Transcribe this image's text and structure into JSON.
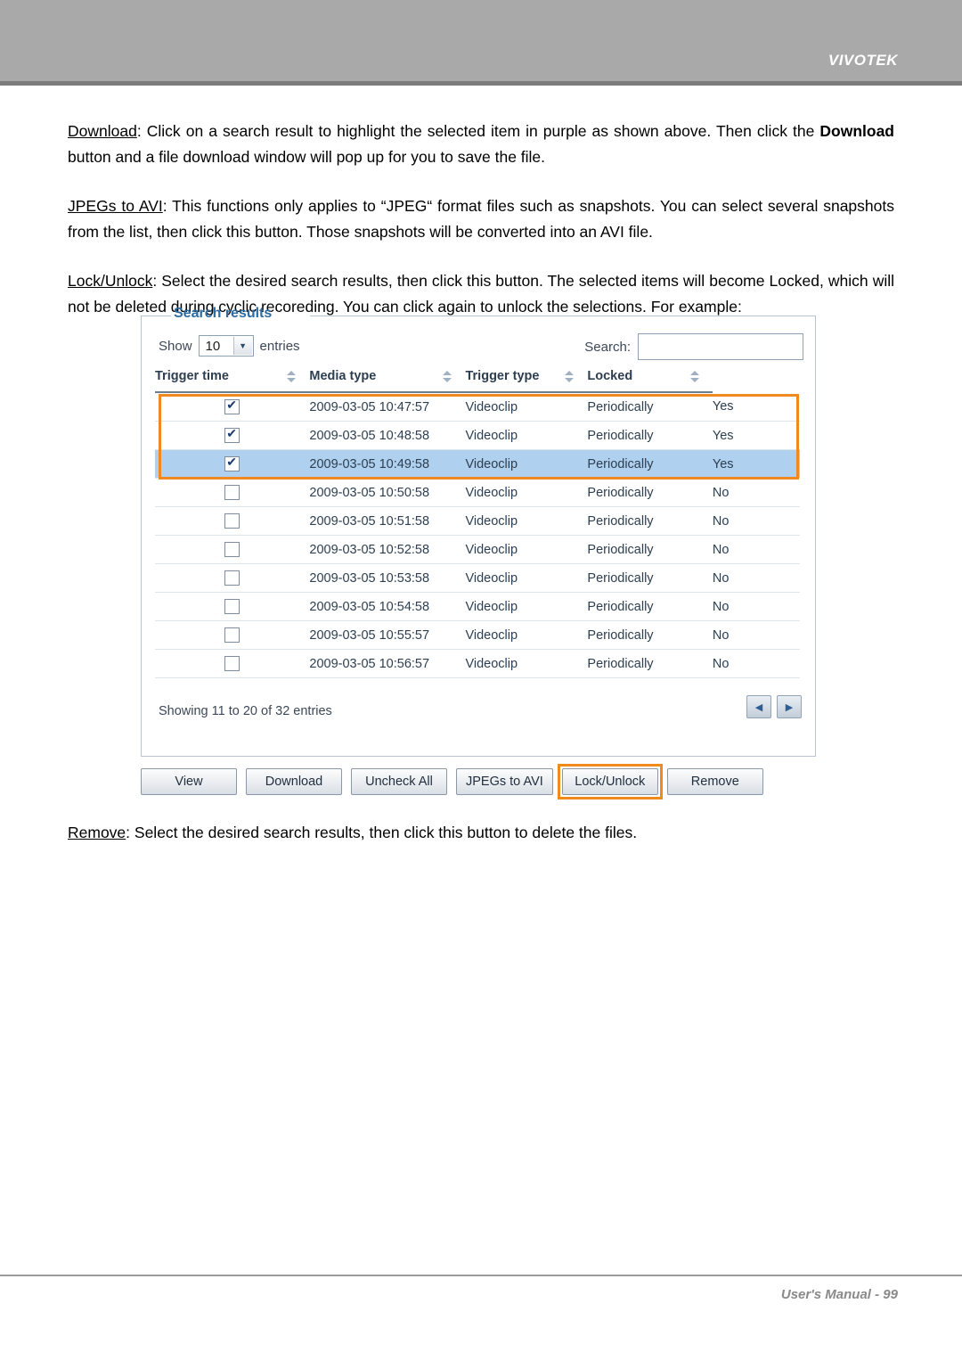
{
  "header": {
    "brand": "VIVOTEK"
  },
  "paragraphs": [
    {
      "term": "Download",
      "term_style": "underline",
      "pre": "",
      "text_1": ": Click on a search result to highlight the selected item in purple as shown above. Then click the ",
      "bold": "Download",
      "text_2": " button and a file download window will pop up for you to save the file."
    },
    {
      "term": "JPEGs to AVI",
      "text_1": ": This functions only applies to “JPEG“ format files such as snapshots. You can select several snapshots from the list, then click this button. Those snapshots will be converted into an AVI file."
    },
    {
      "term": "Lock/Unlock",
      "text_1": ": Select the desired search results, then click this button. The selected items will become Locked, which will not be deleted during cyclic recoreding. You can click again to unlock the selections. For example:"
    }
  ],
  "remove_paragraph": {
    "term": "Remove",
    "text_1": ": Select the desired search results, then click this button to delete the files."
  },
  "screenshot": {
    "legend": "Search results",
    "show_label": "Show",
    "show_value": "10",
    "entries_label": "entries",
    "search_label": "Search:",
    "search_value": "",
    "columns": [
      "Trigger time",
      "Media type",
      "Trigger type",
      "Locked"
    ],
    "rows": [
      {
        "checked": true,
        "selected": false,
        "time": "2009-03-05 10:47:57",
        "media": "Videoclip",
        "trigger": "Periodically",
        "locked": "Yes"
      },
      {
        "checked": true,
        "selected": false,
        "time": "2009-03-05 10:48:58",
        "media": "Videoclip",
        "trigger": "Periodically",
        "locked": "Yes"
      },
      {
        "checked": true,
        "selected": true,
        "time": "2009-03-05 10:49:58",
        "media": "Videoclip",
        "trigger": "Periodically",
        "locked": "Yes"
      },
      {
        "checked": false,
        "selected": false,
        "time": "2009-03-05 10:50:58",
        "media": "Videoclip",
        "trigger": "Periodically",
        "locked": "No"
      },
      {
        "checked": false,
        "selected": false,
        "time": "2009-03-05 10:51:58",
        "media": "Videoclip",
        "trigger": "Periodically",
        "locked": "No"
      },
      {
        "checked": false,
        "selected": false,
        "time": "2009-03-05 10:52:58",
        "media": "Videoclip",
        "trigger": "Periodically",
        "locked": "No"
      },
      {
        "checked": false,
        "selected": false,
        "time": "2009-03-05 10:53:58",
        "media": "Videoclip",
        "trigger": "Periodically",
        "locked": "No"
      },
      {
        "checked": false,
        "selected": false,
        "time": "2009-03-05 10:54:58",
        "media": "Videoclip",
        "trigger": "Periodically",
        "locked": "No"
      },
      {
        "checked": false,
        "selected": false,
        "time": "2009-03-05 10:55:57",
        "media": "Videoclip",
        "trigger": "Periodically",
        "locked": "No"
      },
      {
        "checked": false,
        "selected": false,
        "time": "2009-03-05 10:56:57",
        "media": "Videoclip",
        "trigger": "Periodically",
        "locked": "No"
      }
    ],
    "showing": "Showing 11 to 20 of 32 entries",
    "prev_icon": "◀",
    "next_icon": "▶",
    "buttons": [
      {
        "label": "View",
        "highlighted": false
      },
      {
        "label": "Download",
        "highlighted": false
      },
      {
        "label": "Uncheck All",
        "highlighted": false
      },
      {
        "label": "JPEGs to AVI",
        "highlighted": false
      },
      {
        "label": "Lock/Unlock",
        "highlighted": true
      },
      {
        "label": "Remove",
        "highlighted": false
      }
    ],
    "highlight_color": "#f08a1e",
    "selection_color": "#afd0ef"
  },
  "footer": {
    "text": "User's Manual - 99"
  }
}
